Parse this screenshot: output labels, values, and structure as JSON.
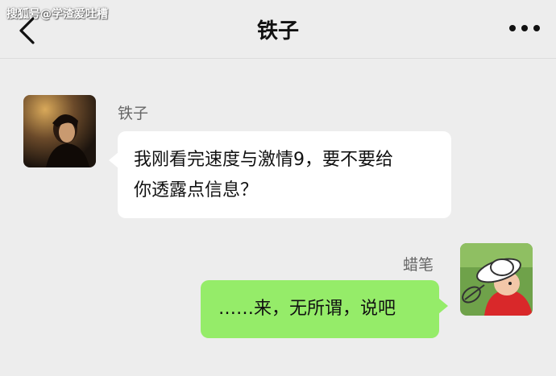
{
  "watermark": "搜狐号@学渣爱吐槽",
  "header": {
    "title": "铁子",
    "back_icon": "chevron-left-icon",
    "more_icon": "more-dots-icon"
  },
  "messages": [
    {
      "sender": "铁子",
      "side": "left",
      "text_line1": "我刚看完速度与激情9，要不要给",
      "text_line2": "你透露点信息？"
    },
    {
      "sender": "蜡笔",
      "side": "right",
      "text": "……来，无所谓，说吧"
    }
  ],
  "colors": {
    "background": "#ededed",
    "incoming_bubble": "#ffffff",
    "outgoing_bubble": "#95ec69"
  }
}
